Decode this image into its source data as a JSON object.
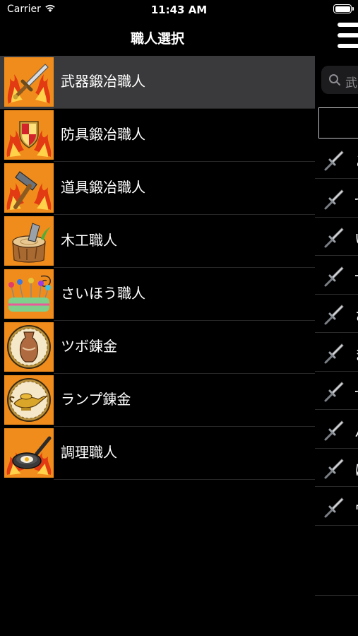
{
  "status_bar": {
    "carrier": "Carrier",
    "time": "11:43 AM"
  },
  "nav": {
    "title": "職人選択"
  },
  "crafts": [
    {
      "label": "武器鍛冶職人",
      "icon": "sword-fire-icon",
      "selected": true
    },
    {
      "label": "防具鍛冶職人",
      "icon": "shield-fire-icon",
      "selected": false
    },
    {
      "label": "道具鍛冶職人",
      "icon": "hammer-fire-icon",
      "selected": false
    },
    {
      "label": "木工職人",
      "icon": "tree-stump-icon",
      "selected": false
    },
    {
      "label": "さいほう職人",
      "icon": "pincushion-icon",
      "selected": false
    },
    {
      "label": "ツボ錬金",
      "icon": "pot-icon",
      "selected": false
    },
    {
      "label": "ランプ錬金",
      "icon": "magic-lamp-icon",
      "selected": false
    },
    {
      "label": "調理職人",
      "icon": "frying-pan-icon",
      "selected": false
    }
  ],
  "peek": {
    "search_placeholder": "武",
    "rows": [
      "と",
      "せ",
      "い",
      "-",
      "さ",
      "ま",
      "せ",
      "バ",
      "に",
      "ウ"
    ]
  },
  "colors": {
    "accent": "#f08c1c",
    "selected_row": "#3a3a3c"
  }
}
